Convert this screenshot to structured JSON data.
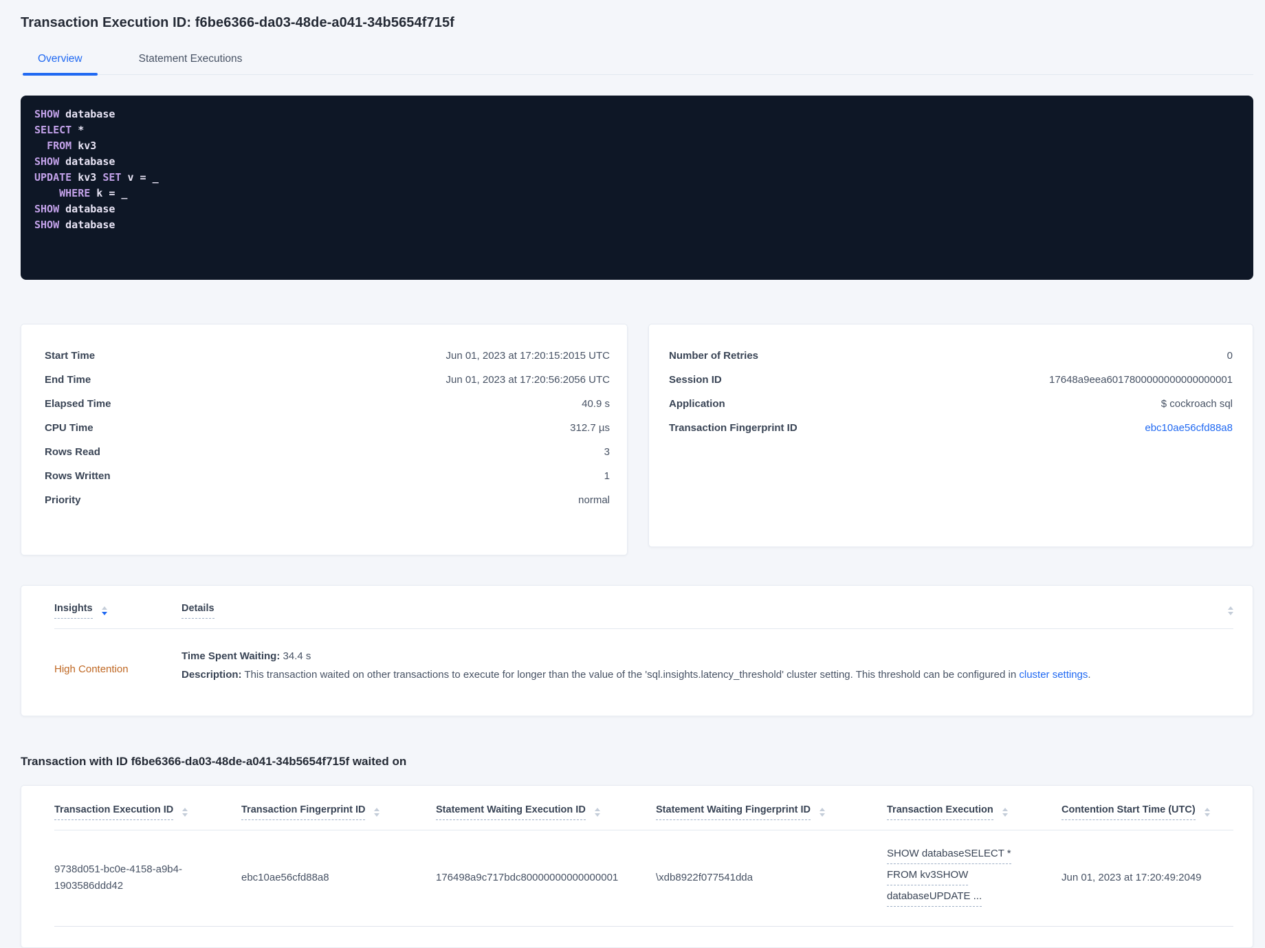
{
  "page": {
    "title": "Transaction Execution ID: f6be6366-da03-48de-a041-34b5654f715f"
  },
  "tabs": [
    {
      "label": "Overview",
      "active": true
    },
    {
      "label": "Statement Executions",
      "active": false
    }
  ],
  "sql": {
    "lines": [
      [
        [
          "k",
          "SHOW"
        ],
        [
          "t",
          " database"
        ]
      ],
      [
        [
          "k",
          "SELECT"
        ],
        [
          "t",
          " *"
        ]
      ],
      [
        [
          "t",
          "  "
        ],
        [
          "k",
          "FROM"
        ],
        [
          "t",
          " kv3"
        ]
      ],
      [
        [
          "k",
          "SHOW"
        ],
        [
          "t",
          " database"
        ]
      ],
      [
        [
          "k",
          "UPDATE"
        ],
        [
          "t",
          " kv3 "
        ],
        [
          "k",
          "SET"
        ],
        [
          "t",
          " v = _"
        ]
      ],
      [
        [
          "t",
          "    "
        ],
        [
          "k",
          "WHERE"
        ],
        [
          "t",
          " k = _"
        ]
      ],
      [
        [
          "k",
          "SHOW"
        ],
        [
          "t",
          " database"
        ]
      ],
      [
        [
          "k",
          "SHOW"
        ],
        [
          "t",
          " database"
        ]
      ]
    ]
  },
  "exec_stats": {
    "rows": [
      {
        "label": "Start Time",
        "value": "Jun 01, 2023 at 17:20:15:2015 UTC"
      },
      {
        "label": "End Time",
        "value": "Jun 01, 2023 at 17:20:56:2056 UTC"
      },
      {
        "label": "Elapsed Time",
        "value": "40.9 s"
      },
      {
        "label": "CPU Time",
        "value": "312.7 µs"
      },
      {
        "label": "Rows Read",
        "value": "3"
      },
      {
        "label": "Rows Written",
        "value": "1"
      },
      {
        "label": "Priority",
        "value": "normal"
      }
    ]
  },
  "txn_stats": {
    "rows": [
      {
        "label": "Number of Retries",
        "value": "0"
      },
      {
        "label": "Session ID",
        "value": "17648a9eea6017800000000000000001"
      },
      {
        "label": "Application",
        "value": "$ cockroach sql"
      },
      {
        "label": "Transaction Fingerprint ID",
        "value": "ebc10ae56cfd88a8",
        "link": true
      }
    ]
  },
  "insights_table": {
    "columns": {
      "insights": "Insights",
      "details": "Details"
    },
    "row": {
      "insight": "High Contention",
      "waiting_label": "Time Spent Waiting:",
      "waiting_value": " 34.4 s",
      "description_label": "Description:",
      "description_text": " This transaction waited on other transactions to execute for longer than the value of the 'sql.insights.latency_threshold' cluster setting. This threshold can be configured in ",
      "description_link": "cluster settings",
      "description_suffix": "."
    }
  },
  "waited_on": {
    "heading": "Transaction with ID f6be6366-da03-48de-a041-34b5654f715f waited on",
    "columns": [
      "Transaction Execution ID",
      "Transaction Fingerprint ID",
      "Statement Waiting Execution ID",
      "Statement Waiting Fingerprint ID",
      "Transaction Execution",
      "Contention Start Time (UTC)"
    ],
    "row": {
      "transaction_execution_id": "9738d051-bc0e-4158-a9b4-1903586ddd42",
      "transaction_fingerprint_id": "ebc10ae56cfd88a8",
      "statement_waiting_execution_id": "176498a9c717bdc80000000000000001",
      "statement_waiting_fingerprint_id": "\\xdb8922f077541dda",
      "transaction_execution_lines": [
        "SHOW databaseSELECT *",
        "FROM kv3SHOW",
        "databaseUPDATE ..."
      ],
      "contention_start_time": "Jun 01, 2023 at 17:20:49:2049"
    }
  },
  "colors": {
    "accent_blue": "#2069f2",
    "insight_orange": "#bf6722",
    "code_background": "#0e1726",
    "code_keyword": "#c3a2ea",
    "code_text": "#e9e5f6",
    "page_background": "#f4f6fa"
  }
}
